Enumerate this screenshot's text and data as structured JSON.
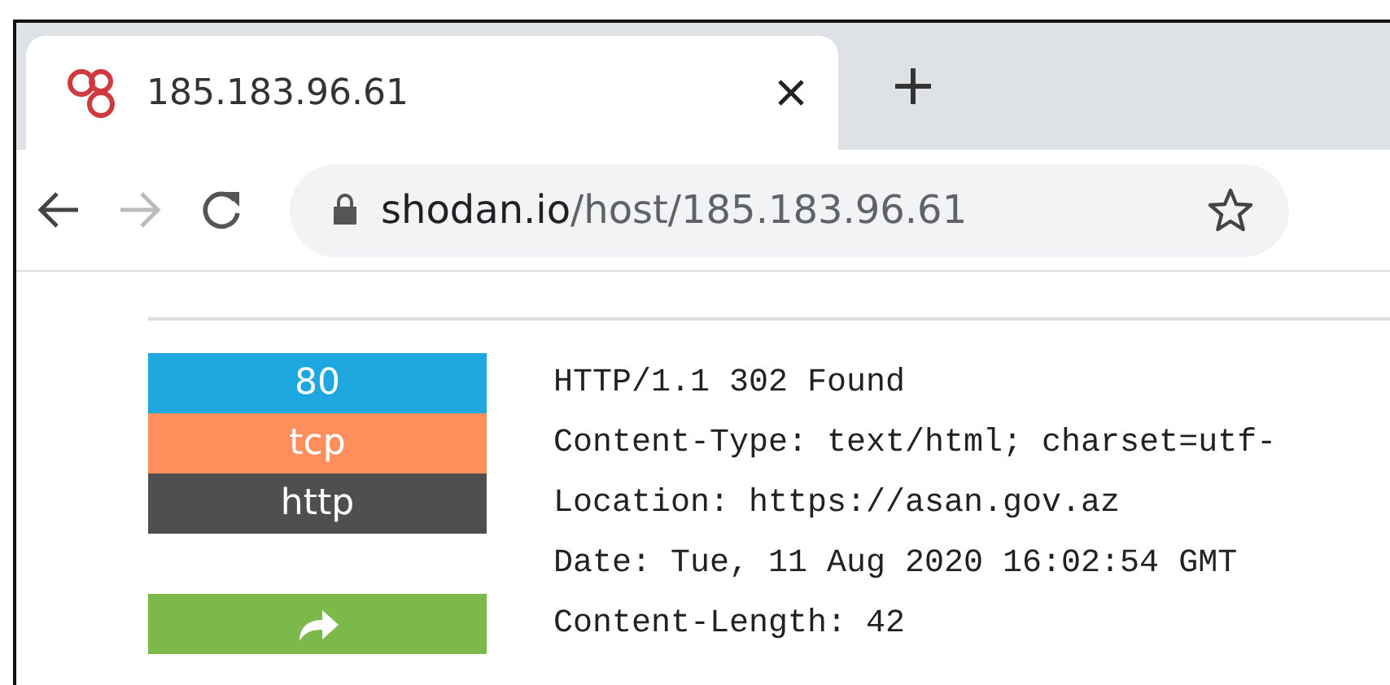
{
  "tab": {
    "title": "185.183.96.61",
    "selected": true
  },
  "address_bar": {
    "domain": "shodan.io",
    "path": "/host/185.183.96.61"
  },
  "navigation": {
    "back_disabled": false,
    "forward_disabled": true
  },
  "service_tags": [
    {
      "kind": "text",
      "label": "80",
      "color": "#1ea8df"
    },
    {
      "kind": "text",
      "label": "tcp",
      "color": "#fe8f5d"
    },
    {
      "kind": "text",
      "label": "http",
      "color": "#4f4f4f"
    },
    {
      "kind": "redirect",
      "color": "#7ab94a"
    }
  ],
  "response_lines": [
    "HTTP/1.1 302 Found",
    "Content-Type: text/html; charset=utf-",
    "Location: https://asan.gov.az",
    "Date: Tue, 11 Aug 2020 16:02:54 GMT",
    "Content-Length: 42"
  ]
}
